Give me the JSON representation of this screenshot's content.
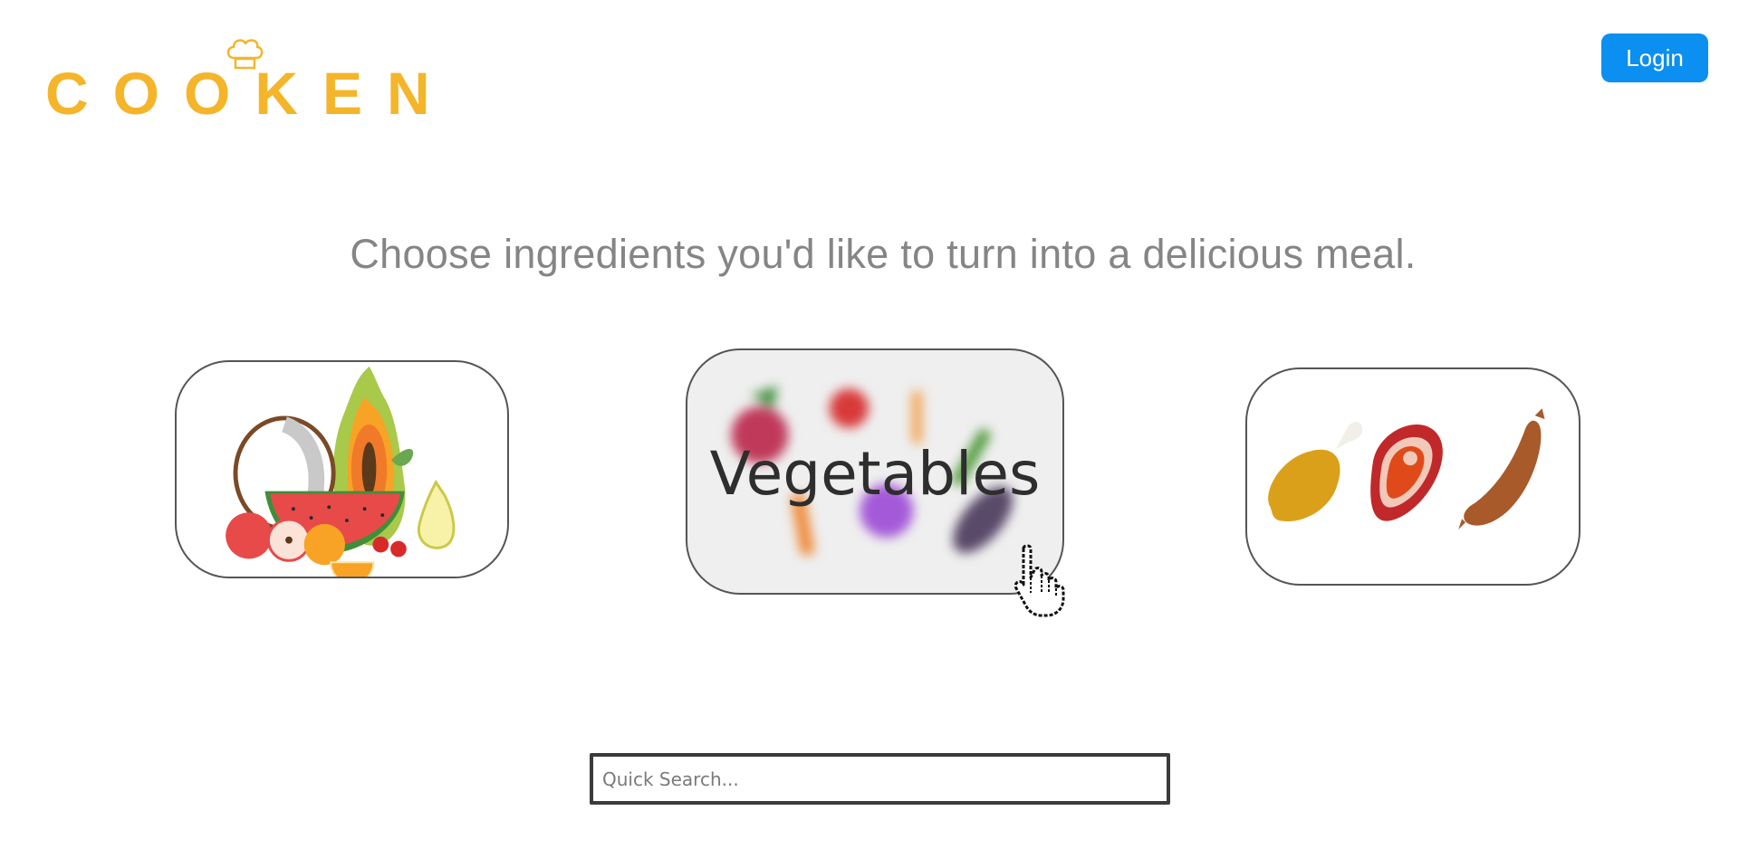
{
  "brand": {
    "logo_text": "COOKEN",
    "logo_color": "#f4b52a"
  },
  "header": {
    "login_label": "Login",
    "login_color": "#0b8ff0"
  },
  "main": {
    "headline": "Choose ingredients you'd like to turn into a delicious meal.",
    "categories": [
      {
        "id": "fruits",
        "label": "",
        "icon": "fruits-illustration"
      },
      {
        "id": "vegetables",
        "label": "Vegetables",
        "icon": "vegetables-illustration",
        "state": "hovered"
      },
      {
        "id": "meat",
        "label": "",
        "icon": "meat-illustration"
      }
    ]
  },
  "search": {
    "placeholder": "Quick Search..."
  }
}
